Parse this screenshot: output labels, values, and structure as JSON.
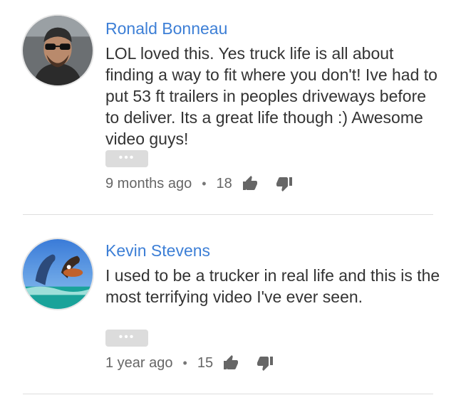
{
  "comments": [
    {
      "author": "Ronald Bonneau",
      "text": "LOL loved this. Yes truck life is all about finding a way to fit where you don't! Ive had to put 53 ft trailers in peoples driveways before to deliver. Its a great life though :) Awesome video guys!",
      "more_label": "•••",
      "time": "9 months ago",
      "separator": "•",
      "likes": "18"
    },
    {
      "author": "Kevin Stevens",
      "text": "I used to be a trucker in real life and this is the most terrifying video I've ever seen.",
      "more_label": "•••",
      "time": "1 year ago",
      "separator": "•",
      "likes": "15"
    }
  ],
  "colors": {
    "author": "#3d7fd6",
    "text": "#333333",
    "meta": "#666666",
    "icon": "#666666"
  },
  "icons": {
    "like": "thumbs-up-icon",
    "dislike": "thumbs-down-icon"
  }
}
